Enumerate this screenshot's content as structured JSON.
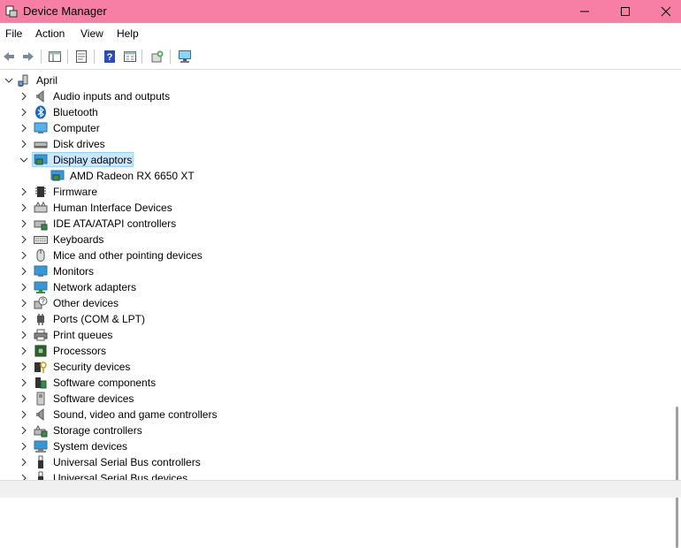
{
  "window": {
    "title": "Device Manager",
    "accent": "#f77fa6"
  },
  "menu": [
    "File",
    "Action",
    "View",
    "Help"
  ],
  "toolbar": [
    "back-icon",
    "forward-icon",
    "show-hide-tree-icon",
    "properties-icon",
    "help-icon",
    "view-icon",
    "update-driver-icon",
    "scan-hardware-icon"
  ],
  "tree": {
    "root": "April",
    "categories": [
      {
        "label": "Audio inputs and outputs",
        "icon": "speaker-icon"
      },
      {
        "label": "Bluetooth",
        "icon": "bluetooth-icon"
      },
      {
        "label": "Computer",
        "icon": "computer-icon"
      },
      {
        "label": "Disk drives",
        "icon": "disk-drive-icon"
      },
      {
        "label": "Display adaptors",
        "icon": "display-adapter-icon",
        "expanded": true,
        "selected": true,
        "children": [
          {
            "label": "AMD Radeon RX 6650 XT",
            "icon": "display-adapter-icon"
          }
        ]
      },
      {
        "label": "Firmware",
        "icon": "firmware-icon"
      },
      {
        "label": "Human Interface Devices",
        "icon": "hid-icon"
      },
      {
        "label": "IDE ATA/ATAPI controllers",
        "icon": "ide-controller-icon"
      },
      {
        "label": "Keyboards",
        "icon": "keyboard-icon"
      },
      {
        "label": "Mice and other pointing devices",
        "icon": "mouse-icon"
      },
      {
        "label": "Monitors",
        "icon": "monitor-icon"
      },
      {
        "label": "Network adapters",
        "icon": "network-adapter-icon"
      },
      {
        "label": "Other devices",
        "icon": "other-devices-icon"
      },
      {
        "label": "Ports (COM & LPT)",
        "icon": "port-icon"
      },
      {
        "label": "Print queues",
        "icon": "printer-icon"
      },
      {
        "label": "Processors",
        "icon": "processor-icon"
      },
      {
        "label": "Security devices",
        "icon": "security-device-icon"
      },
      {
        "label": "Software components",
        "icon": "software-component-icon"
      },
      {
        "label": "Software devices",
        "icon": "software-device-icon"
      },
      {
        "label": "Sound, video and game controllers",
        "icon": "sound-controller-icon"
      },
      {
        "label": "Storage controllers",
        "icon": "storage-controller-icon"
      },
      {
        "label": "System devices",
        "icon": "system-devices-icon"
      },
      {
        "label": "Universal Serial Bus controllers",
        "icon": "usb-icon"
      },
      {
        "label": "Universal Serial Bus devices",
        "icon": "usb-icon"
      }
    ]
  }
}
